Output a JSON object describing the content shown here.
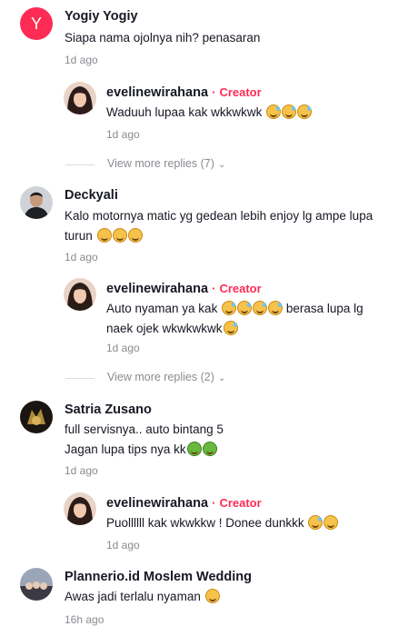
{
  "comments": [
    {
      "name": "Yogiy Yogiy",
      "avatar_letter": "Y",
      "text": "Siapa nama ojolnya nih? penasaran",
      "time": "1d ago",
      "reply": {
        "name": "evelinewirahana",
        "badge": "Creator",
        "text": "Waduuh lupaa kak wkkwkwk",
        "time": "1d ago"
      },
      "view_more": "View more replies (7)"
    },
    {
      "name": "Deckyali",
      "text_line1": "Kalo motornya matic yg gedean lebih enjoy lg ampe lupa",
      "text_line2": "turun",
      "time": "1d ago",
      "reply": {
        "name": "evelinewirahana",
        "badge": "Creator",
        "text_line1": "Auto nyaman ya kak",
        "text_line1b": "berasa lupa lg",
        "text_line2": "naek ojek wkwkwkwk",
        "time": "1d ago"
      },
      "view_more": "View more replies (2)"
    },
    {
      "name": "Satria Zusano",
      "text_line1": "full servisnya.. auto bintang 5",
      "text_line2": "Jagan lupa tips nya kk",
      "time": "1d ago",
      "reply": {
        "name": "evelinewirahana",
        "badge": "Creator",
        "text": "Puollllll kak wkwkkw ! Donee dunkkk",
        "time": "1d ago"
      }
    },
    {
      "name": "Plannerio.id Moslem Wedding",
      "text": "Awas jadi terlalu nyaman",
      "time": "16h ago"
    }
  ],
  "colors": {
    "accent": "#fe2c55",
    "muted": "#8a8b91",
    "avatar_y": "#fe2c55"
  },
  "icons": [
    "chevron-down-icon",
    "grinning-sweat-emoji",
    "money-mouth-emoji"
  ]
}
